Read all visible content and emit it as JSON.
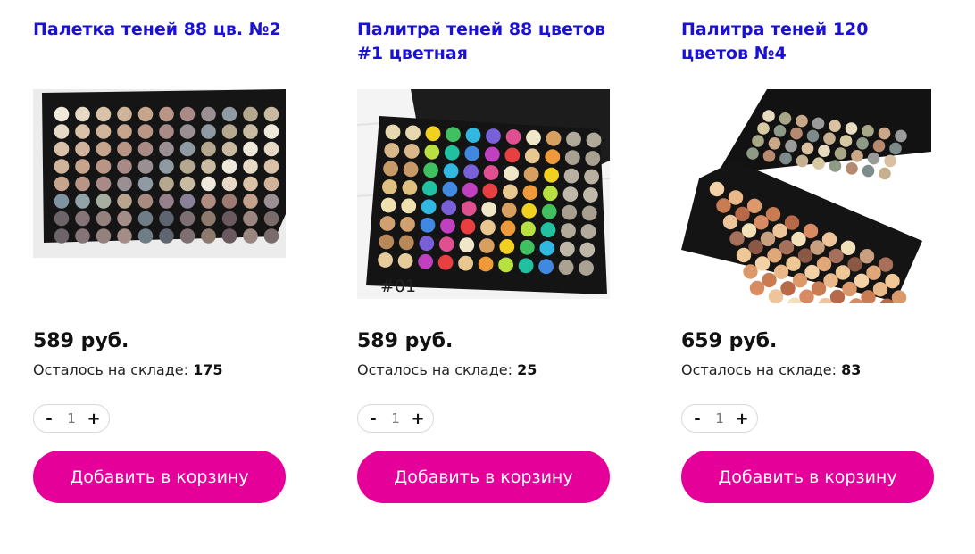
{
  "colors": {
    "title_link": "#1a10d6",
    "cart_button": "#e6009a",
    "cart_text": "#ffffff"
  },
  "products": [
    {
      "title": "Палетка теней 88 цв. №2",
      "image_label": "",
      "price": "589 руб.",
      "stock_label": "Осталось на складе:",
      "stock_count": "175",
      "quantity": "1",
      "minus": "-",
      "plus": "+",
      "cart_label": "Добавить в корзину"
    },
    {
      "title": "Палитра теней 88 цветов #1 цветная",
      "image_label": "#01",
      "price": "589 руб.",
      "stock_label": "Осталось на складе:",
      "stock_count": "25",
      "quantity": "1",
      "minus": "-",
      "plus": "+",
      "cart_label": "Добавить в корзину"
    },
    {
      "title": "Палитра теней 120 цветов №4",
      "image_label": "",
      "price": "659 руб.",
      "stock_label": "Осталось на складе:",
      "stock_count": "83",
      "quantity": "1",
      "minus": "-",
      "plus": "+",
      "cart_label": "Добавить в корзину"
    }
  ]
}
